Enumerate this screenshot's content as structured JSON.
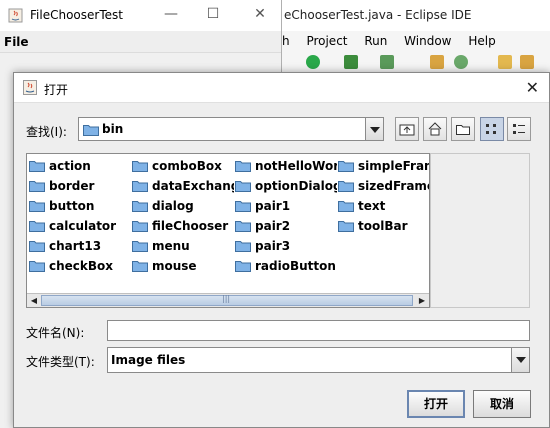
{
  "background_window": {
    "title": "FileChooserTest",
    "menu_file": "File"
  },
  "eclipse": {
    "title": "eChooserTest.java - Eclipse IDE",
    "menu": [
      "h",
      "Project",
      "Run",
      "Window",
      "Help"
    ]
  },
  "dialog": {
    "title": "打开",
    "look_in_label": "查找(I):",
    "look_in_value": "bin",
    "files": [
      [
        "action",
        "border",
        "button",
        "calculator",
        "chart13",
        "checkBox"
      ],
      [
        "comboBox",
        "dataExchange",
        "dialog",
        "fileChooser",
        "menu",
        "mouse"
      ],
      [
        "notHelloWorld",
        "optionDialog",
        "pair1",
        "pair2",
        "pair3",
        "radioButton"
      ],
      [
        "simpleFrame",
        "sizedFrame",
        "text",
        "toolBar"
      ]
    ],
    "filename_label": "文件名(N):",
    "filename_value": "",
    "filetype_label": "文件类型(T):",
    "filetype_value": "Image files",
    "open_button": "打开",
    "cancel_button": "取消"
  },
  "colors": {
    "folder_fill": "#7fb2e6",
    "folder_stroke": "#3f6f9f",
    "java_red": "#d0452b",
    "default_button_border": "#6a86b0"
  }
}
